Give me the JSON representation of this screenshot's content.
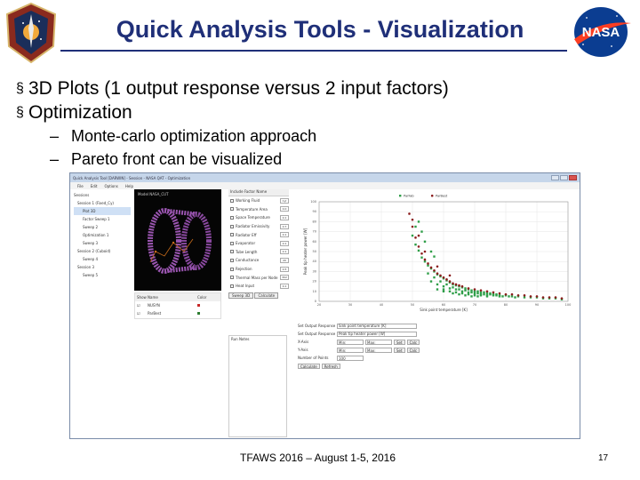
{
  "slide": {
    "title": "Quick Analysis Tools - Visualization",
    "title_color": "#1f2f78",
    "bullets": [
      "3D Plots (1 output response versus 2 input factors)",
      "Optimization"
    ],
    "bullet_marker": "§",
    "sub_bullets": [
      "Monte-carlo optimization approach",
      "Pareto front can be visualized"
    ],
    "sub_marker": "–",
    "footer": "TFAWS 2016 – August 1-5, 2016",
    "page_number": "17",
    "logos": {
      "left": "tfaws-patch-logo",
      "right": "nasa-meatball-logo"
    }
  },
  "app": {
    "window_title": "Quick Analysis Tool [DARWIN] - Session - NASA QAT - Optimization",
    "menu": [
      "File",
      "Edit",
      "Options",
      "Help"
    ],
    "tree": [
      "Sessions",
      "Session 1 (Fixed_Cy)",
      "Plot 3D",
      "Factor Sweep 1",
      "Sweep 2",
      "Optimization 1",
      "Sweep 3",
      "Session 2 (Cuboid)",
      "Sweep 4",
      "Session 3",
      "Sweep 5"
    ],
    "plot3d_title": "Model NASA_CUT",
    "series_table": {
      "headers": [
        "Show",
        "Name",
        "Color"
      ],
      "rows": [
        {
          "name": "NUSYN",
          "color": "#c62828"
        },
        {
          "name": "ParBest",
          "color": "#2e7d32"
        }
      ]
    },
    "factors": {
      "header": "Include Factor Name",
      "rows": [
        {
          "name": "Working Fluid",
          "value": "Cyl"
        },
        {
          "name": "Temperature Area",
          "value": "0.0"
        },
        {
          "name": "Space Temperature",
          "value": "0.1"
        },
        {
          "name": "Radiator Emissivity",
          "value": "0.7"
        },
        {
          "name": "Radiator Eff",
          "value": "0.1"
        },
        {
          "name": "Evaporator",
          "value": "0.1"
        },
        {
          "name": "Tube Length",
          "value": "0.1"
        },
        {
          "name": "Conductance",
          "value": "20"
        },
        {
          "name": "Rejection",
          "value": "0.5"
        },
        {
          "name": "Thermal Mass per Node",
          "value": "302"
        },
        {
          "name": "Heat Input",
          "value": "0.1"
        }
      ],
      "buttons": [
        "Sweep 3D",
        "Calculate"
      ],
      "subpanel_title": "Run Notes"
    },
    "controls": {
      "rows": [
        {
          "label": "Set Output Response",
          "value": "Sink point temperature [K]"
        },
        {
          "label": "Set Output Response",
          "value": "Peak tip heater power [W]"
        }
      ],
      "range_rows": [
        {
          "label": "X-Axis",
          "min": "Min:",
          "max": "Max:"
        },
        {
          "label": "Y-Axis",
          "min": "Min:",
          "max": "Max:"
        }
      ],
      "range_buttons": [
        "Set",
        "Calc"
      ],
      "points_label": "Number of Points",
      "points_value": "100",
      "action_buttons": [
        "Calculate",
        "Refresh"
      ]
    }
  },
  "chart_data": {
    "type": "scatter",
    "xlabel": "Sink point temperature [K]",
    "ylabel": "Peak tip heater power [W]",
    "xlim": [
      20,
      100
    ],
    "ylim": [
      0,
      100
    ],
    "xticks": [
      "20",
      "30",
      "40",
      "50",
      "60",
      "70",
      "80",
      "90",
      "100"
    ],
    "yticks": [
      "0",
      "10",
      "20",
      "30",
      "40",
      "50",
      "60",
      "70",
      "80",
      "90",
      "100"
    ],
    "legend_position": "top-left",
    "grid": true,
    "series": [
      {
        "name": "ParFab",
        "color": "#2e9e48",
        "marker": "square",
        "points": [
          [
            50,
            66
          ],
          [
            51,
            57
          ],
          [
            52,
            51
          ],
          [
            53,
            44
          ],
          [
            54,
            40
          ],
          [
            55,
            36
          ],
          [
            56,
            33
          ],
          [
            57,
            30
          ],
          [
            58,
            27
          ],
          [
            59,
            25
          ],
          [
            60,
            23
          ],
          [
            61,
            21
          ],
          [
            62,
            19
          ],
          [
            63,
            17
          ],
          [
            64,
            16
          ],
          [
            65,
            15
          ],
          [
            66,
            14
          ],
          [
            67,
            13
          ],
          [
            68,
            12
          ],
          [
            69,
            11
          ],
          [
            70,
            10
          ],
          [
            71,
            10
          ],
          [
            72,
            9
          ],
          [
            73,
            9
          ],
          [
            74,
            8
          ],
          [
            75,
            8
          ],
          [
            76,
            7
          ],
          [
            77,
            7
          ],
          [
            78,
            6
          ],
          [
            80,
            6
          ],
          [
            82,
            5
          ],
          [
            84,
            5
          ],
          [
            86,
            4
          ],
          [
            88,
            4
          ],
          [
            90,
            4
          ],
          [
            92,
            3
          ],
          [
            94,
            3
          ],
          [
            96,
            3
          ],
          [
            98,
            2
          ],
          [
            55,
            28
          ],
          [
            57,
            24
          ],
          [
            59,
            20
          ],
          [
            61,
            17
          ],
          [
            63,
            14
          ],
          [
            65,
            12
          ],
          [
            67,
            11
          ],
          [
            69,
            9
          ],
          [
            71,
            8
          ],
          [
            73,
            7
          ],
          [
            75,
            7
          ],
          [
            77,
            6
          ],
          [
            79,
            5
          ],
          [
            81,
            5
          ],
          [
            83,
            4
          ],
          [
            56,
            20
          ],
          [
            58,
            17
          ],
          [
            60,
            15
          ],
          [
            62,
            13
          ],
          [
            64,
            12
          ],
          [
            66,
            10
          ],
          [
            68,
            9
          ],
          [
            70,
            8
          ],
          [
            72,
            7
          ],
          [
            74,
            6
          ],
          [
            76,
            6
          ],
          [
            78,
            5
          ],
          [
            60,
            12
          ],
          [
            62,
            10
          ],
          [
            64,
            9
          ],
          [
            66,
            8
          ],
          [
            68,
            7
          ],
          [
            70,
            6
          ],
          [
            72,
            6
          ],
          [
            74,
            5
          ],
          [
            58,
            12
          ],
          [
            60,
            10
          ],
          [
            63,
            8
          ],
          [
            65,
            7
          ],
          [
            67,
            6
          ],
          [
            69,
            5
          ],
          [
            71,
            5
          ],
          [
            53,
            70
          ],
          [
            52,
            80
          ],
          [
            51,
            75
          ],
          [
            54,
            60
          ],
          [
            57,
            45
          ],
          [
            56,
            50
          ]
        ]
      },
      {
        "name": "ParBest",
        "color": "#8b1c1c",
        "marker": "circle",
        "points": [
          [
            49,
            88
          ],
          [
            50,
            75
          ],
          [
            51,
            64
          ],
          [
            52,
            55
          ],
          [
            53,
            48
          ],
          [
            54,
            42
          ],
          [
            55,
            38
          ],
          [
            56,
            34
          ],
          [
            57,
            31
          ],
          [
            58,
            28
          ],
          [
            59,
            26
          ],
          [
            60,
            24
          ],
          [
            61,
            22
          ],
          [
            62,
            20
          ],
          [
            63,
            18
          ],
          [
            64,
            17
          ],
          [
            65,
            16
          ],
          [
            66,
            15
          ],
          [
            68,
            13
          ],
          [
            70,
            12
          ],
          [
            72,
            11
          ],
          [
            74,
            10
          ],
          [
            76,
            9
          ],
          [
            78,
            8
          ],
          [
            80,
            7
          ],
          [
            82,
            7
          ],
          [
            84,
            6
          ],
          [
            86,
            6
          ],
          [
            88,
            5
          ],
          [
            90,
            5
          ],
          [
            92,
            4
          ],
          [
            94,
            4
          ],
          [
            96,
            4
          ],
          [
            98,
            3
          ],
          [
            50,
            82
          ],
          [
            52,
            66
          ],
          [
            54,
            50
          ],
          [
            58,
            35
          ],
          [
            62,
            26
          ]
        ]
      }
    ]
  }
}
